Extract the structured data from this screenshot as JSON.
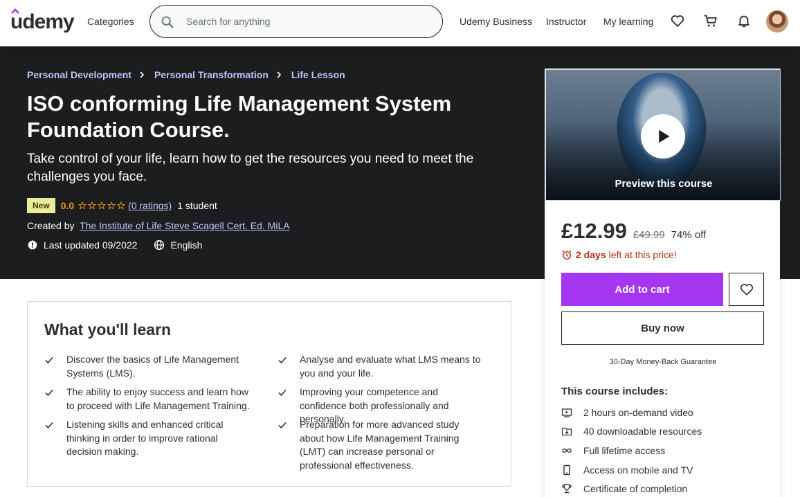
{
  "header": {
    "logo": "udemy",
    "categories_label": "Categories",
    "search_placeholder": "Search for anything",
    "udemy_business_label": "Udemy Business",
    "instructor_label": "Instructor",
    "my_learning_label": "My learning"
  },
  "breadcrumb": [
    "Personal Development",
    "Personal Transformation",
    "Life Lesson"
  ],
  "course": {
    "title": "ISO conforming Life Management System Foundation Course.",
    "subtitle": "Take control of your life, learn how to get the resources you need to meet the challenges you face.",
    "badge": "New",
    "rating": "0.0",
    "rating_stars": 0,
    "ratings_count": "(0 ratings)",
    "students": "1 student",
    "created_by_label": "Created by",
    "author": "The Institute of Life Steve Scagell Cert. Ed. MiLA",
    "last_updated": "Last updated 09/2022",
    "language": "English"
  },
  "learn": {
    "title": "What you'll learn",
    "items": [
      "Discover the basics of Life Management Systems (LMS).",
      "Analyse and evaluate what LMS means to you and your life.",
      "The ability to enjoy success and learn how to proceed with Life Management Training.",
      "Improving your competence and confidence both professionally and personally.",
      "Listening skills and enhanced critical thinking in order to improve rational decision making.",
      "Preparation for more advanced study about how Life Management Training (LMT) can increase personal or professional effectiveness."
    ]
  },
  "card": {
    "preview_label": "Preview this course",
    "price_now": "£12.99",
    "price_old": "£49.99",
    "discount": "74% off",
    "timer_days": "2 days",
    "timer_rest": "left at this price!",
    "add_to_cart": "Add to cart",
    "buy_now": "Buy now",
    "guarantee": "30-Day Money-Back Guarantee",
    "includes_title": "This course includes:",
    "includes": [
      "2 hours on-demand video",
      "40 downloadable resources",
      "Full lifetime access",
      "Access on mobile and TV",
      "Certificate of completion"
    ]
  },
  "colors": {
    "brand_purple": "#a435f0",
    "hero_bg": "#1c1d1f",
    "link_purple": "#c0c4fc",
    "rating_orange": "#f69c08",
    "timer_red": "#b32d0f",
    "badge_yellow": "#eceb98"
  }
}
